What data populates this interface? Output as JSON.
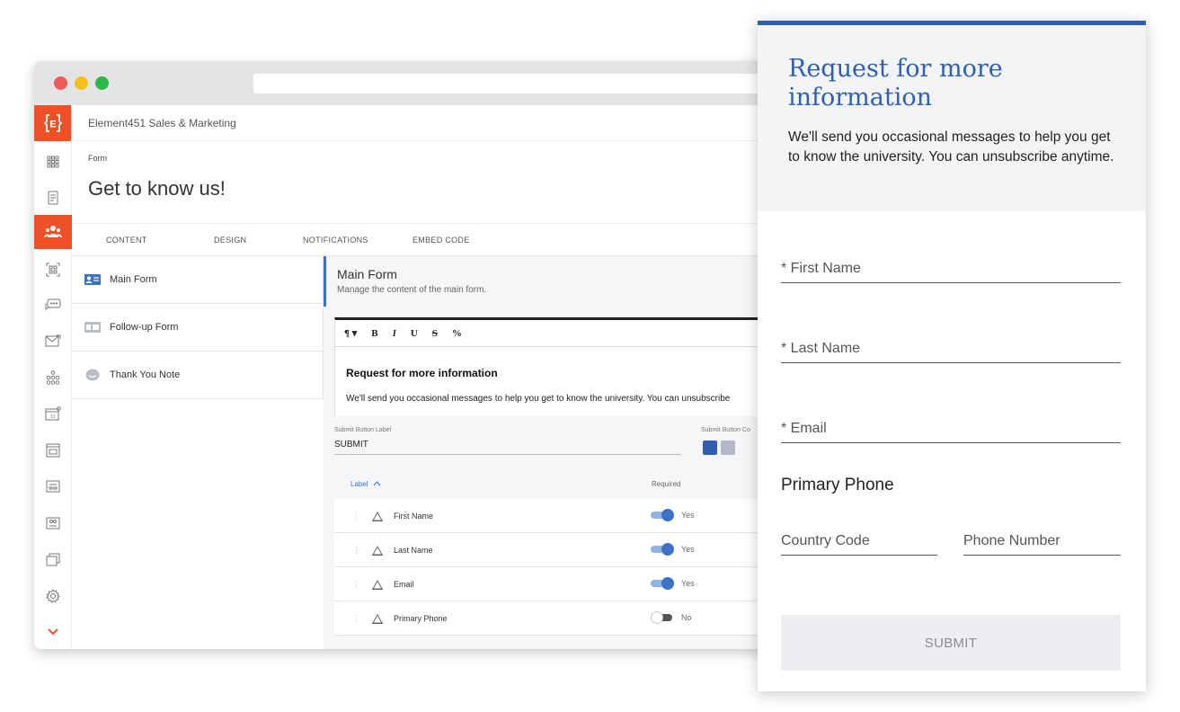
{
  "app": {
    "name": "Element451 Sales & Marketing",
    "logo_letter": "E",
    "brand_color": "#ee5125",
    "accent_color": "#3c72c4"
  },
  "sidebar": {
    "icons": [
      "apps-grid-icon",
      "document-icon",
      "people-icon",
      "scan-icon",
      "chat-icon",
      "mail-icon",
      "sitemap-icon",
      "calendar-icon",
      "form-icon",
      "panel-icon",
      "badge-icon",
      "layers-icon",
      "gear-icon",
      "chevron-down-icon"
    ]
  },
  "page": {
    "breadcrumb": "Form",
    "title": "Get to know us!"
  },
  "tabs": [
    {
      "label": "CONTENT"
    },
    {
      "label": "DESIGN"
    },
    {
      "label": "NOTIFICATIONS"
    },
    {
      "label": "EMBED CODE"
    }
  ],
  "left_panel": {
    "items": [
      {
        "label": "Main Form",
        "icon": "id-card-icon"
      },
      {
        "label": "Follow-up Form",
        "icon": "id-card-icon"
      },
      {
        "label": "Thank You Note",
        "icon": "smiley-icon"
      }
    ]
  },
  "main_form": {
    "title": "Main Form",
    "subtitle": "Manage the content of the main form.",
    "editor": {
      "toolbar": [
        "¶ ▾",
        "B",
        "I",
        "U",
        "S",
        "%"
      ],
      "heading": "Request for more information",
      "body": "We'll send you occasional messages to help you get to know the university. You can unsubscribe"
    },
    "submit_label_caption": "Submit Button Label",
    "submit_label_value": "SUBMIT",
    "submit_color_caption": "Submit Button Co",
    "swatch_colors": [
      "#2e5fb5",
      "#b4b8c6"
    ],
    "table": {
      "label_header": "Label",
      "sort_icon": "chevron-up-icon",
      "required_header": "Required",
      "rows": [
        {
          "name": "First Name",
          "required": true,
          "required_label": "Yes"
        },
        {
          "name": "Last Name",
          "required": true,
          "required_label": "Yes"
        },
        {
          "name": "Email",
          "required": true,
          "required_label": "Yes"
        },
        {
          "name": "Primary Phone",
          "required": false,
          "required_label": "No"
        }
      ]
    }
  },
  "preview_form": {
    "title": "Request for more information",
    "description": "We'll send you occasional messages to help you get to know the university. You can unsubscribe anytime.",
    "fields": [
      {
        "placeholder": "* First Name"
      },
      {
        "placeholder": "* Last Name"
      },
      {
        "placeholder": "* Email"
      }
    ],
    "phone_section_label": "Primary Phone",
    "country_code_placeholder": "Country Code",
    "phone_number_placeholder": "Phone Number",
    "submit_label": "SUBMIT",
    "accent_color": "#2e5fb5"
  }
}
